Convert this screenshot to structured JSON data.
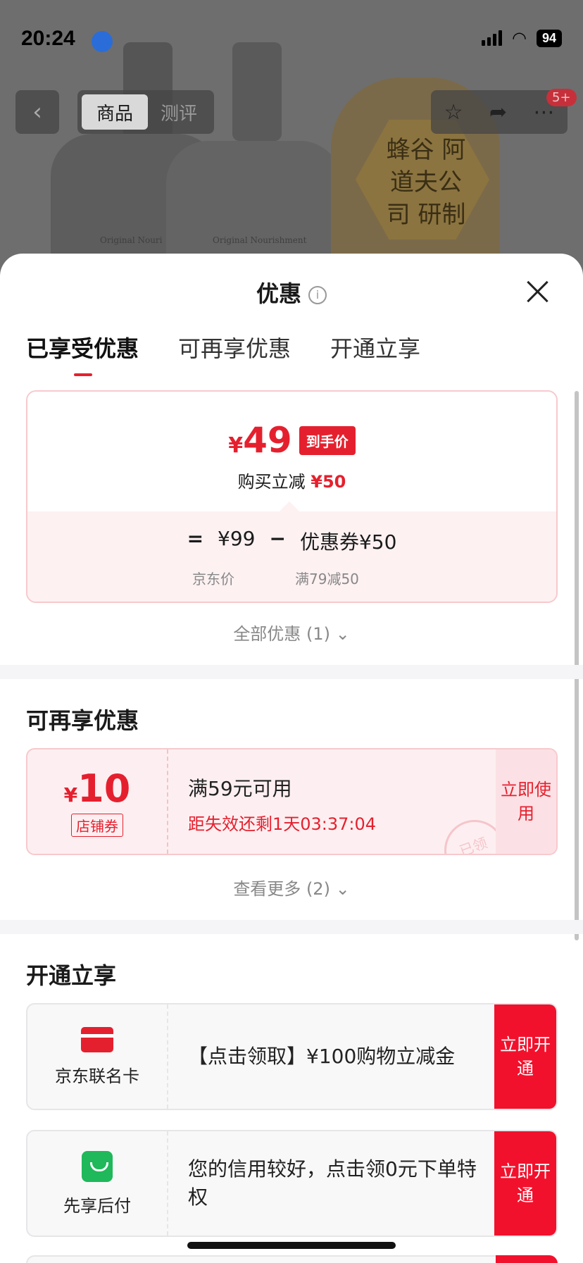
{
  "status": {
    "time": "20:24",
    "battery": "94"
  },
  "product_bg": {
    "label_1": "Original Nouri",
    "label_2": "Original Nourishment",
    "gold_text": "蜂谷 阿道夫公司 研制"
  },
  "nav": {
    "tab_goods": "商品",
    "tab_review": "测评",
    "badge": "5+"
  },
  "sheet": {
    "title": "优惠",
    "tabs": [
      "已享受优惠",
      "可再享优惠",
      "开通立享"
    ],
    "enjoyed": {
      "currency": "¥",
      "final_price": "49",
      "price_tag": "到手价",
      "reduce_label": "购买立减",
      "reduce_amount": "¥50",
      "eq": "=",
      "jd_price": "¥99",
      "minus": "−",
      "coupon_amt": "优惠券¥50",
      "jd_price_label": "京东价",
      "coupon_rule": "满79减50"
    },
    "all_discounts": "全部优惠 (1) ⌄",
    "more_section": {
      "title": "可再享优惠",
      "coupon": {
        "currency": "¥",
        "amount": "10",
        "kind": "店铺券",
        "condition": "满59元可用",
        "expiry": "距失效还剩1天03:37:04",
        "stamp": "已领",
        "button": "立即使用"
      },
      "see_more": "查看更多 (2) ⌄"
    },
    "open_section": {
      "title": "开通立享",
      "items": [
        {
          "label": "京东联名卡",
          "desc": "【点击领取】¥100购物立减金",
          "button": "立即开通"
        },
        {
          "label": "先享后付",
          "desc": "您的信用较好，点击领0元下单特权",
          "button": "立即开通"
        }
      ]
    }
  }
}
